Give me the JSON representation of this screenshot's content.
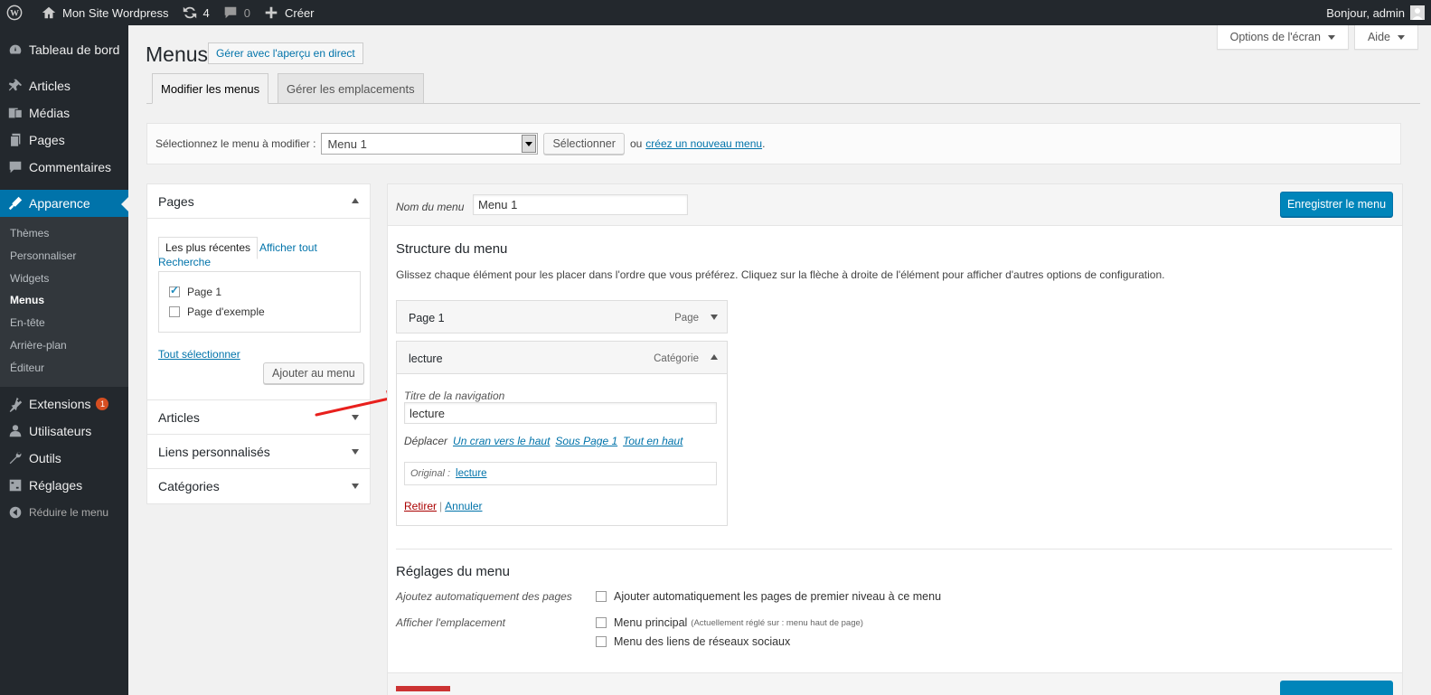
{
  "adminbar": {
    "site_name": "Mon Site Wordpress",
    "updates_count": "4",
    "comments_count": "0",
    "new_label": "Créer",
    "greeting": "Bonjour, admin"
  },
  "sidebar": {
    "items": [
      {
        "label": "Tableau de bord",
        "icon": "dashboard-icon"
      },
      {
        "label": "Articles",
        "icon": "pin-icon"
      },
      {
        "label": "Médias",
        "icon": "media-icon"
      },
      {
        "label": "Pages",
        "icon": "pages-icon"
      },
      {
        "label": "Commentaires",
        "icon": "comment-icon"
      },
      {
        "label": "Apparence",
        "icon": "appearance-icon"
      }
    ],
    "submenu": [
      "Thèmes",
      "Personnaliser",
      "Widgets",
      "Menus",
      "En-tête",
      "Arrière-plan",
      "Éditeur"
    ],
    "lower_items": [
      {
        "label": "Extensions",
        "icon": "plugins-icon",
        "badge": "1"
      },
      {
        "label": "Utilisateurs",
        "icon": "users-icon"
      },
      {
        "label": "Outils",
        "icon": "tools-icon"
      },
      {
        "label": "Réglages",
        "icon": "settings-icon"
      }
    ],
    "collapse_label": "Réduire le menu"
  },
  "screen_options": {
    "options_label": "Options de l'écran",
    "help_label": "Aide"
  },
  "page": {
    "title": "Menus",
    "live_preview_label": "Gérer avec l'aperçu en direct",
    "tabs": [
      "Modifier les menus",
      "Gérer les emplacements"
    ]
  },
  "manage": {
    "select_label": "Sélectionnez le menu à modifier :",
    "selected_menu": "Menu 1",
    "select_button": "Sélectionner",
    "or_text": "ou",
    "create_link": "créez un nouveau menu",
    "period": "."
  },
  "left_panel": {
    "pages_title": "Pages",
    "subtabs": [
      "Les plus récentes",
      "Afficher tout",
      "Recherche"
    ],
    "pages": [
      {
        "label": "Page 1",
        "checked": true
      },
      {
        "label": "Page d'exemple",
        "checked": false
      }
    ],
    "select_all": "Tout sélectionner",
    "add_button": "Ajouter au menu",
    "sections": [
      "Articles",
      "Liens personnalisés",
      "Catégories"
    ]
  },
  "menu_editor": {
    "name_label": "Nom du menu",
    "name_value": "Menu 1",
    "save_label": "Enregistrer le menu",
    "structure_title": "Structure du menu",
    "structure_desc": "Glissez chaque élément pour les placer dans l'ordre que vous préférez. Cliquez sur la flèche à droite de l'élément pour afficher d'autres options de configuration.",
    "items": [
      {
        "title": "Page 1",
        "type": "Page"
      },
      {
        "title": "lecture",
        "type": "Catégorie"
      }
    ],
    "nav_label_caption": "Titre de la navigation",
    "nav_label_value": "lecture",
    "move_label": "Déplacer",
    "move_links": [
      "Un cran vers le haut",
      "Sous Page 1",
      "Tout en haut"
    ],
    "original_label": "Original :",
    "original_link": "lecture",
    "remove_label": "Retirer",
    "separator": "|",
    "cancel_label": "Annuler",
    "settings_title": "Réglages du menu",
    "auto_add_label": "Ajoutez automatiquement des pages",
    "auto_add_option": "Ajouter automatiquement les pages de premier niveau à ce menu",
    "locations_label": "Afficher l'emplacement",
    "location_primary": "Menu principal",
    "location_primary_note": "(Actuellement réglé sur : menu haut de page)",
    "location_social": "Menu des liens de réseaux sociaux"
  },
  "colors": {
    "accent": "#0073aa",
    "primary_button": "#0085ba",
    "annotation_arrow": "#e8201d",
    "badge": "#d54e21",
    "remove_link": "#a00"
  }
}
